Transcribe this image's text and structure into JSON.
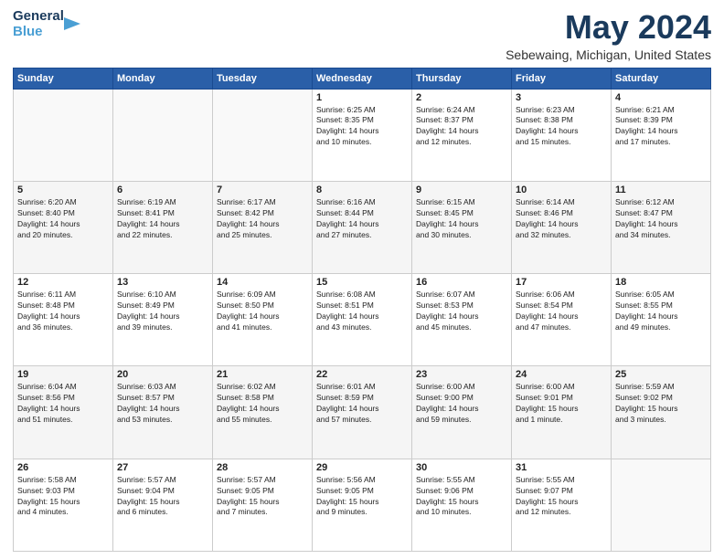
{
  "header": {
    "logo_line1": "General",
    "logo_line2": "Blue",
    "title": "May 2024",
    "subtitle": "Sebewaing, Michigan, United States"
  },
  "weekdays": [
    "Sunday",
    "Monday",
    "Tuesday",
    "Wednesday",
    "Thursday",
    "Friday",
    "Saturday"
  ],
  "weeks": [
    [
      {
        "day": "",
        "info": ""
      },
      {
        "day": "",
        "info": ""
      },
      {
        "day": "",
        "info": ""
      },
      {
        "day": "1",
        "info": "Sunrise: 6:25 AM\nSunset: 8:35 PM\nDaylight: 14 hours\nand 10 minutes."
      },
      {
        "day": "2",
        "info": "Sunrise: 6:24 AM\nSunset: 8:37 PM\nDaylight: 14 hours\nand 12 minutes."
      },
      {
        "day": "3",
        "info": "Sunrise: 6:23 AM\nSunset: 8:38 PM\nDaylight: 14 hours\nand 15 minutes."
      },
      {
        "day": "4",
        "info": "Sunrise: 6:21 AM\nSunset: 8:39 PM\nDaylight: 14 hours\nand 17 minutes."
      }
    ],
    [
      {
        "day": "5",
        "info": "Sunrise: 6:20 AM\nSunset: 8:40 PM\nDaylight: 14 hours\nand 20 minutes."
      },
      {
        "day": "6",
        "info": "Sunrise: 6:19 AM\nSunset: 8:41 PM\nDaylight: 14 hours\nand 22 minutes."
      },
      {
        "day": "7",
        "info": "Sunrise: 6:17 AM\nSunset: 8:42 PM\nDaylight: 14 hours\nand 25 minutes."
      },
      {
        "day": "8",
        "info": "Sunrise: 6:16 AM\nSunset: 8:44 PM\nDaylight: 14 hours\nand 27 minutes."
      },
      {
        "day": "9",
        "info": "Sunrise: 6:15 AM\nSunset: 8:45 PM\nDaylight: 14 hours\nand 30 minutes."
      },
      {
        "day": "10",
        "info": "Sunrise: 6:14 AM\nSunset: 8:46 PM\nDaylight: 14 hours\nand 32 minutes."
      },
      {
        "day": "11",
        "info": "Sunrise: 6:12 AM\nSunset: 8:47 PM\nDaylight: 14 hours\nand 34 minutes."
      }
    ],
    [
      {
        "day": "12",
        "info": "Sunrise: 6:11 AM\nSunset: 8:48 PM\nDaylight: 14 hours\nand 36 minutes."
      },
      {
        "day": "13",
        "info": "Sunrise: 6:10 AM\nSunset: 8:49 PM\nDaylight: 14 hours\nand 39 minutes."
      },
      {
        "day": "14",
        "info": "Sunrise: 6:09 AM\nSunset: 8:50 PM\nDaylight: 14 hours\nand 41 minutes."
      },
      {
        "day": "15",
        "info": "Sunrise: 6:08 AM\nSunset: 8:51 PM\nDaylight: 14 hours\nand 43 minutes."
      },
      {
        "day": "16",
        "info": "Sunrise: 6:07 AM\nSunset: 8:53 PM\nDaylight: 14 hours\nand 45 minutes."
      },
      {
        "day": "17",
        "info": "Sunrise: 6:06 AM\nSunset: 8:54 PM\nDaylight: 14 hours\nand 47 minutes."
      },
      {
        "day": "18",
        "info": "Sunrise: 6:05 AM\nSunset: 8:55 PM\nDaylight: 14 hours\nand 49 minutes."
      }
    ],
    [
      {
        "day": "19",
        "info": "Sunrise: 6:04 AM\nSunset: 8:56 PM\nDaylight: 14 hours\nand 51 minutes."
      },
      {
        "day": "20",
        "info": "Sunrise: 6:03 AM\nSunset: 8:57 PM\nDaylight: 14 hours\nand 53 minutes."
      },
      {
        "day": "21",
        "info": "Sunrise: 6:02 AM\nSunset: 8:58 PM\nDaylight: 14 hours\nand 55 minutes."
      },
      {
        "day": "22",
        "info": "Sunrise: 6:01 AM\nSunset: 8:59 PM\nDaylight: 14 hours\nand 57 minutes."
      },
      {
        "day": "23",
        "info": "Sunrise: 6:00 AM\nSunset: 9:00 PM\nDaylight: 14 hours\nand 59 minutes."
      },
      {
        "day": "24",
        "info": "Sunrise: 6:00 AM\nSunset: 9:01 PM\nDaylight: 15 hours\nand 1 minute."
      },
      {
        "day": "25",
        "info": "Sunrise: 5:59 AM\nSunset: 9:02 PM\nDaylight: 15 hours\nand 3 minutes."
      }
    ],
    [
      {
        "day": "26",
        "info": "Sunrise: 5:58 AM\nSunset: 9:03 PM\nDaylight: 15 hours\nand 4 minutes."
      },
      {
        "day": "27",
        "info": "Sunrise: 5:57 AM\nSunset: 9:04 PM\nDaylight: 15 hours\nand 6 minutes."
      },
      {
        "day": "28",
        "info": "Sunrise: 5:57 AM\nSunset: 9:05 PM\nDaylight: 15 hours\nand 7 minutes."
      },
      {
        "day": "29",
        "info": "Sunrise: 5:56 AM\nSunset: 9:05 PM\nDaylight: 15 hours\nand 9 minutes."
      },
      {
        "day": "30",
        "info": "Sunrise: 5:55 AM\nSunset: 9:06 PM\nDaylight: 15 hours\nand 10 minutes."
      },
      {
        "day": "31",
        "info": "Sunrise: 5:55 AM\nSunset: 9:07 PM\nDaylight: 15 hours\nand 12 minutes."
      },
      {
        "day": "",
        "info": ""
      }
    ]
  ]
}
